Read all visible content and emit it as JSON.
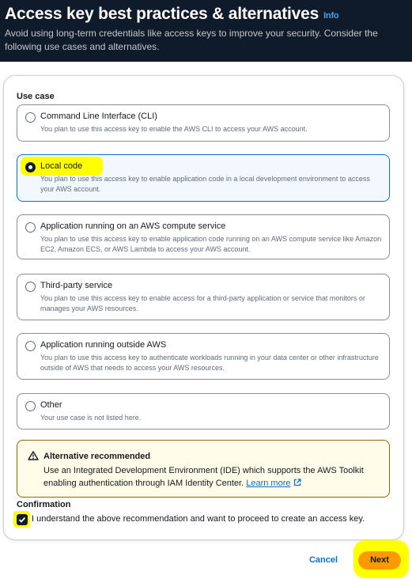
{
  "header": {
    "title": "Access key best practices & alternatives",
    "info_label": "Info",
    "description": "Avoid using long-term credentials like access keys to improve your security. Consider the following use cases and alternatives."
  },
  "use_case": {
    "label": "Use case",
    "selected_index": 1,
    "options": [
      {
        "title": "Command Line Interface (CLI)",
        "description": "You plan to use this access key to enable the AWS CLI to access your AWS account."
      },
      {
        "title": "Local code",
        "description": "You plan to use this access key to enable application code in a local development environment to access your AWS account."
      },
      {
        "title": "Application running on an AWS compute service",
        "description": "You plan to use this access key to enable application code running on an AWS compute service like Amazon EC2, Amazon ECS, or AWS Lambda to access your AWS account."
      },
      {
        "title": "Third-party service",
        "description": "You plan to use this access key to enable access for a third-party application or service that monitors or manages your AWS resources."
      },
      {
        "title": "Application running outside AWS",
        "description": "You plan to use this access key to authenticate workloads running in your data center or other infrastructure outside of AWS that needs to access your AWS resources."
      },
      {
        "title": "Other",
        "description": "Your use case is not listed here."
      }
    ]
  },
  "alert": {
    "title": "Alternative recommended",
    "text": "Use an Integrated Development Environment (IDE) which supports the AWS Toolkit enabling authentication through IAM Identity Center.",
    "link_label": "Learn more",
    "icon": "warning-icon"
  },
  "confirmation": {
    "label": "Confirmation",
    "checked": true,
    "text": "I understand the above recommendation and want to proceed to create an access key."
  },
  "actions": {
    "cancel_label": "Cancel",
    "next_label": "Next"
  },
  "colors": {
    "header_bg": "#0f1b2a",
    "primary_button": "#ff9900",
    "link": "#0972d3",
    "highlight": "#ffff00",
    "alert_bg": "#fffce9"
  }
}
